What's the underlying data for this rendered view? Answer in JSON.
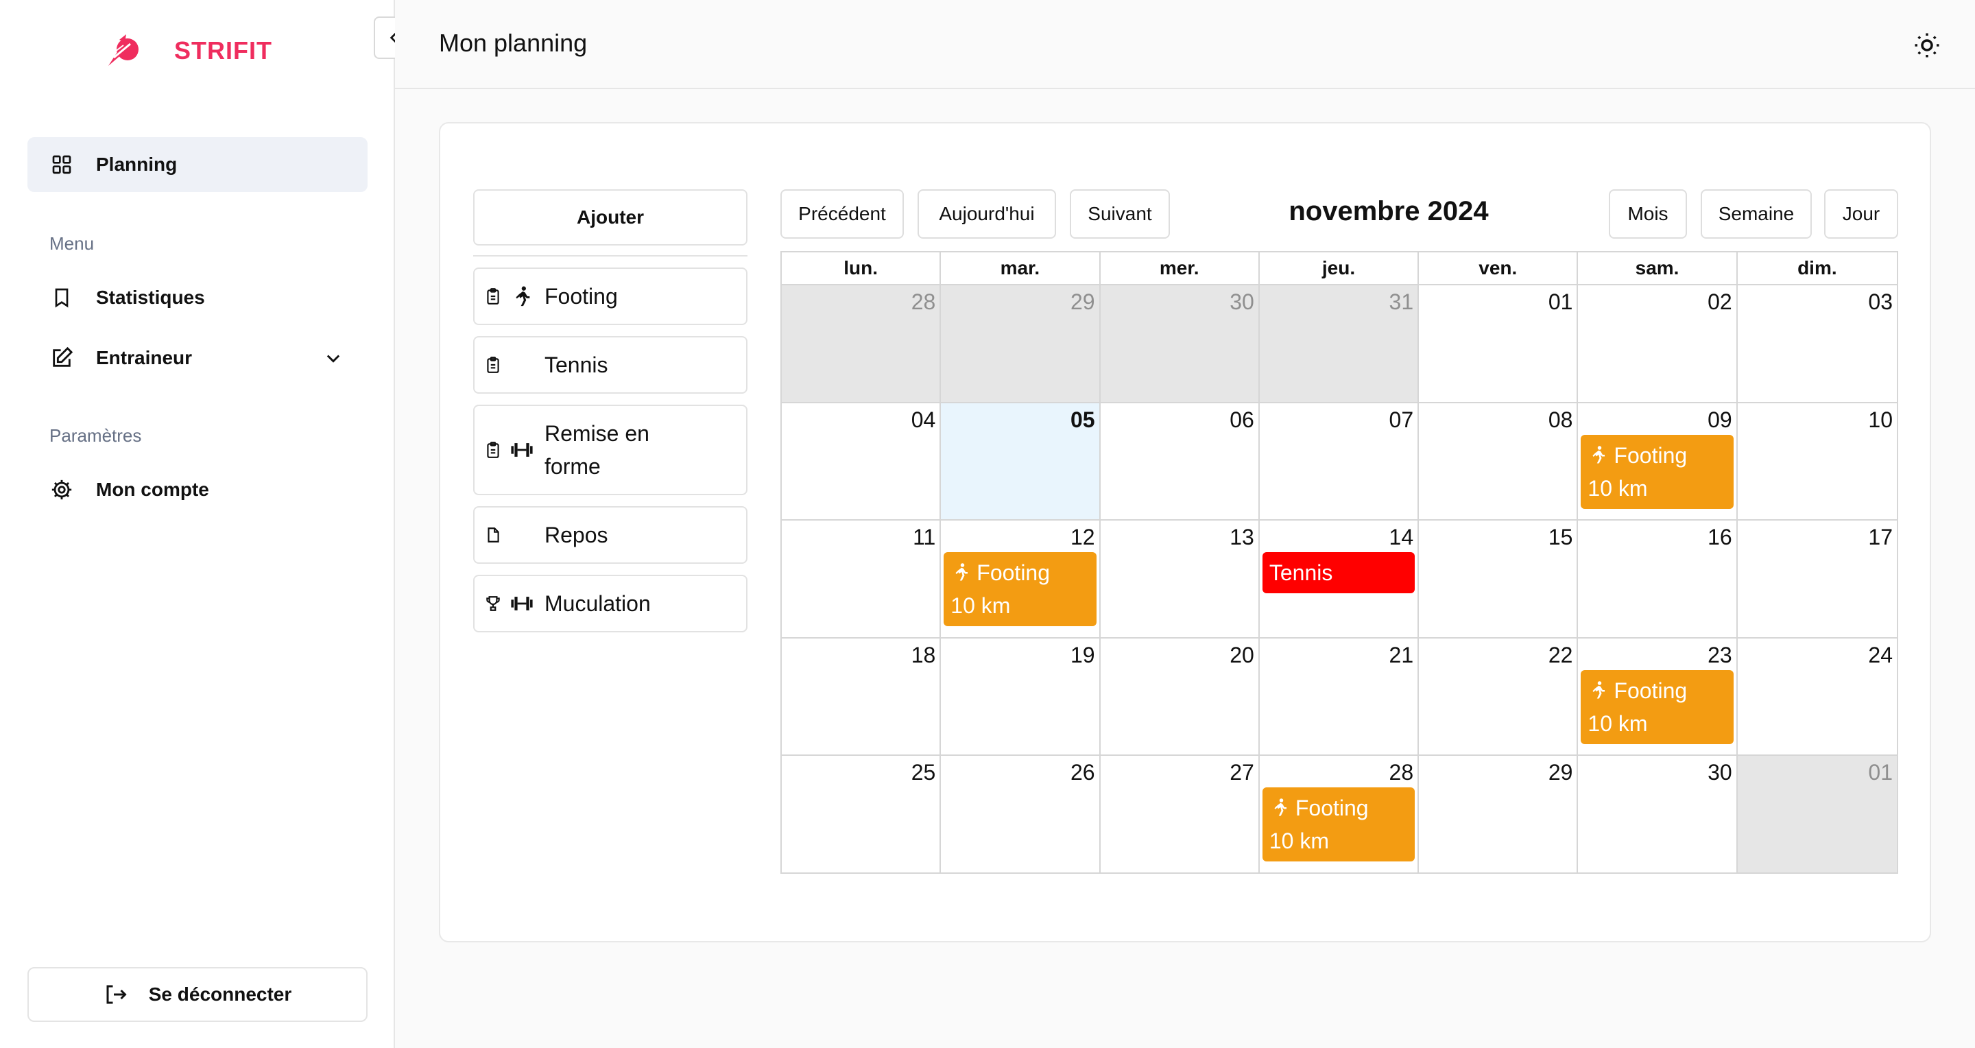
{
  "app": {
    "brand": "STRIFIT"
  },
  "colors": {
    "brand": "#ef2d5e",
    "footing": "#f39c12",
    "tennis": "#ff0000",
    "today": "#e9f5fd",
    "outside_month": "#e6e6e6"
  },
  "sidebar": {
    "primary_item": {
      "label": "Planning",
      "icon": "grid-icon"
    },
    "menu_label": "Menu",
    "menu_items": [
      {
        "label": "Statistiques",
        "icon": "bookmark-icon"
      },
      {
        "label": "Entraineur",
        "icon": "edit-icon",
        "expandable": true
      }
    ],
    "settings_label": "Paramètres",
    "settings_items": [
      {
        "label": "Mon compte",
        "icon": "gear-icon"
      }
    ],
    "logout_label": "Se déconnecter"
  },
  "header": {
    "title": "Mon planning"
  },
  "external_events": {
    "add_label": "Ajouter",
    "items": [
      {
        "label": "Footing",
        "type_icon": "clipboard-icon",
        "activity_icon": "runner-icon"
      },
      {
        "label": "Tennis",
        "type_icon": "clipboard-icon",
        "activity_icon": ""
      },
      {
        "label": "Remise en forme",
        "type_icon": "clipboard-icon",
        "activity_icon": "dumbbell-icon"
      },
      {
        "label": "Repos",
        "type_icon": "file-icon",
        "activity_icon": ""
      },
      {
        "label": "Muculation",
        "type_icon": "trophy-icon",
        "activity_icon": "dumbbell-icon"
      }
    ]
  },
  "calendar": {
    "title": "novembre 2024",
    "nav": {
      "prev": "Précédent",
      "today": "Aujourd'hui",
      "next": "Suivant"
    },
    "views": {
      "month": "Mois",
      "week": "Semaine",
      "day": "Jour"
    },
    "weekdays": [
      "lun.",
      "mar.",
      "mer.",
      "jeu.",
      "ven.",
      "sam.",
      "dim."
    ],
    "today": "05",
    "weeks": [
      [
        {
          "d": "28",
          "o": true
        },
        {
          "d": "29",
          "o": true
        },
        {
          "d": "30",
          "o": true
        },
        {
          "d": "31",
          "o": true
        },
        {
          "d": "01"
        },
        {
          "d": "02"
        },
        {
          "d": "03"
        }
      ],
      [
        {
          "d": "04"
        },
        {
          "d": "05",
          "t": true
        },
        {
          "d": "06"
        },
        {
          "d": "07"
        },
        {
          "d": "08"
        },
        {
          "d": "09",
          "ev": [
            {
              "title": "Footing",
              "detail": "10 km",
              "kind": "footing"
            }
          ]
        },
        {
          "d": "10"
        }
      ],
      [
        {
          "d": "11"
        },
        {
          "d": "12",
          "ev": [
            {
              "title": "Footing",
              "detail": "10 km",
              "kind": "footing"
            }
          ]
        },
        {
          "d": "13"
        },
        {
          "d": "14",
          "ev": [
            {
              "title": "Tennis",
              "detail": "",
              "kind": "tennis"
            }
          ]
        },
        {
          "d": "15"
        },
        {
          "d": "16"
        },
        {
          "d": "17"
        }
      ],
      [
        {
          "d": "18"
        },
        {
          "d": "19"
        },
        {
          "d": "20"
        },
        {
          "d": "21"
        },
        {
          "d": "22"
        },
        {
          "d": "23",
          "ev": [
            {
              "title": "Footing",
              "detail": "10 km",
              "kind": "footing"
            }
          ]
        },
        {
          "d": "24"
        }
      ],
      [
        {
          "d": "25"
        },
        {
          "d": "26"
        },
        {
          "d": "27"
        },
        {
          "d": "28",
          "ev": [
            {
              "title": "Footing",
              "detail": "10 km",
              "kind": "footing"
            }
          ]
        },
        {
          "d": "29"
        },
        {
          "d": "30"
        },
        {
          "d": "01",
          "o": true
        }
      ]
    ]
  }
}
